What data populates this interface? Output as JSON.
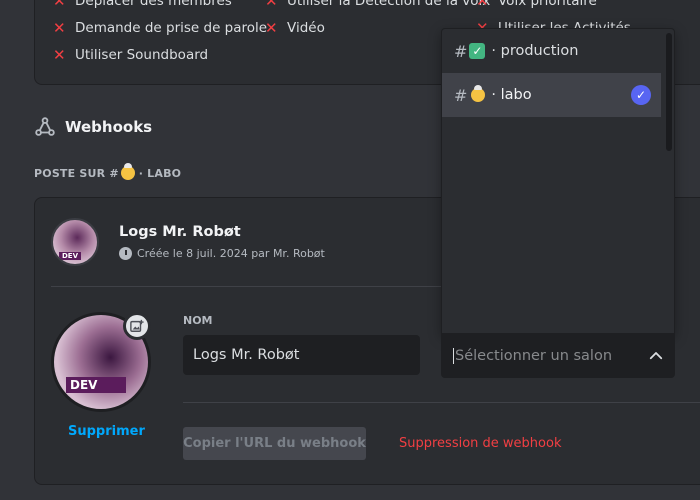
{
  "permissions": {
    "items": [
      {
        "label": "Déplacer des membres"
      },
      {
        "label": "Utiliser la Détection de la voix"
      },
      {
        "label": "Voix prioritaire"
      },
      {
        "label": "Demande de prise de parole"
      },
      {
        "label": "Vidéo"
      },
      {
        "label": "Utiliser les Activités"
      },
      {
        "label": "Utiliser Soundboard"
      }
    ],
    "denied_icon": "x-icon"
  },
  "webhooks": {
    "title": "Webhooks",
    "post_label_prefix": "POSTE SUR #",
    "post_channel": "· LABO",
    "webhook": {
      "name": "Logs Mr. Robøt",
      "created": "Créée le 8 juil. 2024 par Mr. Robøt",
      "avatar_badge": "DEV",
      "name_field_label": "NOM",
      "name_value": "Logs Mr. Robøt",
      "delete_label": "Supprimer",
      "copy_url_label": "Copier l'URL du webhook",
      "delete_webhook_label": "Suppression de webhook"
    }
  },
  "channel_dropdown": {
    "options": [
      {
        "hash": "#",
        "emoji": "✓",
        "name": "· production",
        "selected": false
      },
      {
        "hash": "#",
        "emoji": "face-emoji",
        "name": "· labo",
        "selected": true
      }
    ],
    "placeholder": "Sélectionner un salon",
    "check_mark": "✓"
  },
  "colors": {
    "accent": "#5865f2",
    "danger": "#f23f43",
    "link": "#00a8fc",
    "emoji_green": "#43b581"
  }
}
